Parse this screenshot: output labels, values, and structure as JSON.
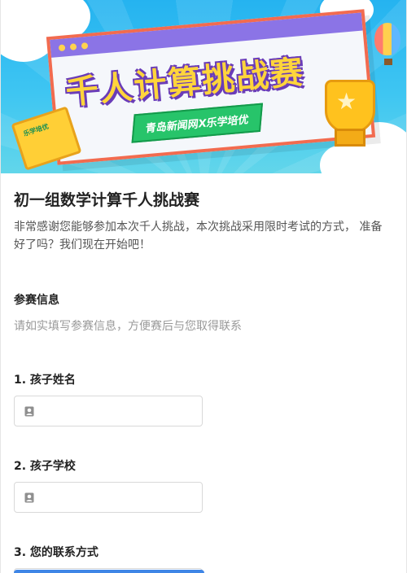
{
  "banner": {
    "title": "千人计算挑战赛",
    "subtitle": "青岛新闻网X乐学培优",
    "book_label": "乐学培优"
  },
  "form": {
    "title": "初一组数学计算千人挑战赛",
    "description": "非常感谢您能够参加本次千人挑战，本次挑战采用限时考试的方式， 准备好了吗？我们现在开始吧！"
  },
  "section": {
    "title": "参赛信息",
    "description": "请如实填写参赛信息，方便赛后与您取得联系"
  },
  "fields": [
    {
      "label": "1. 孩子姓名",
      "icon": "person-icon",
      "value": ""
    },
    {
      "label": "2. 孩子学校",
      "icon": "person-icon",
      "value": ""
    },
    {
      "label": "3. 您的联系方式",
      "icon": "phone-icon",
      "value": ""
    }
  ],
  "colors": {
    "accent": "#3f86e6",
    "banner_sky": "#25b3f0",
    "title_yellow": "#ffd53b",
    "ribbon_green": "#27c46a"
  }
}
